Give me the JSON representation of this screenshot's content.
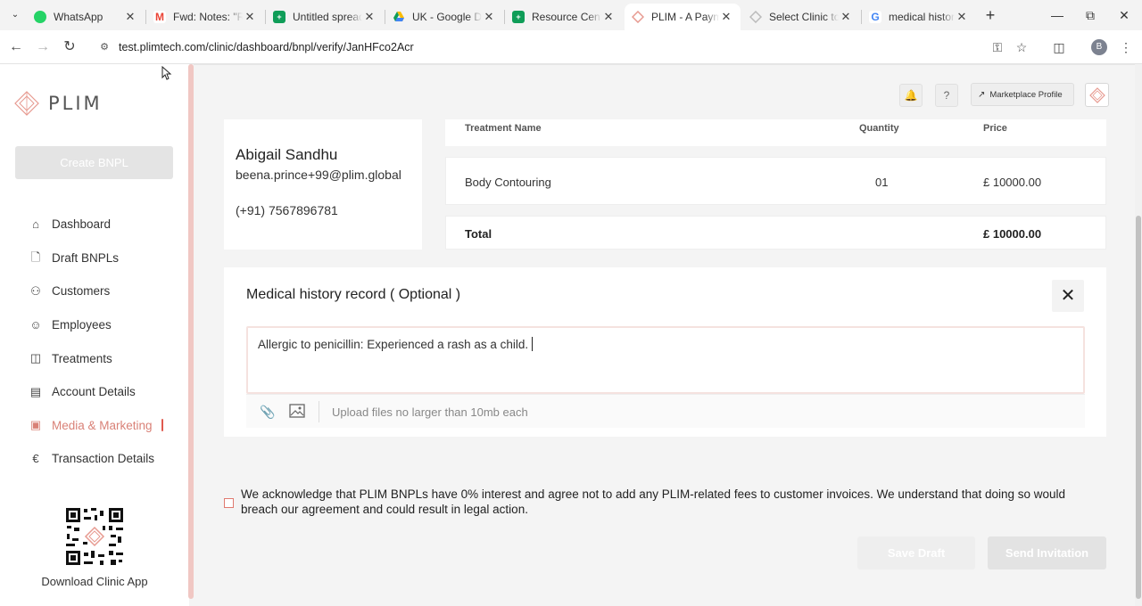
{
  "browser": {
    "tabs": [
      {
        "title": "WhatsApp",
        "favicon": "whatsapp-icon",
        "color": "#25d366"
      },
      {
        "title": "Fwd: Notes: \"Re",
        "favicon": "gmail-icon",
        "color": "#ea4335"
      },
      {
        "title": "Untitled spreads",
        "favicon": "sheets-icon",
        "color": "#0f9d58"
      },
      {
        "title": "UK - Google Driv",
        "favicon": "drive-icon",
        "color": "#4285f4"
      },
      {
        "title": "Resource Centre",
        "favicon": "sheets-icon",
        "color": "#0f9d58"
      },
      {
        "title": "PLIM - A Paymen",
        "favicon": "plim-icon",
        "color": "#e79a90"
      },
      {
        "title": "Select Clinic to c",
        "favicon": "plim-icon",
        "color": "#bbbbbb"
      },
      {
        "title": "medical history c",
        "favicon": "google-icon",
        "color": "#4285f4"
      }
    ],
    "active_tab": 5,
    "url": "test.plimtech.com/clinic/dashboard/bnpl/verify/JanHFco2Acr",
    "profile_initial": "B"
  },
  "sidebar": {
    "brand": "PLIM",
    "create_button": "Create BNPL",
    "items": [
      {
        "label": "Dashboard",
        "icon": "home-icon"
      },
      {
        "label": "Draft BNPLs",
        "icon": "file-icon"
      },
      {
        "label": "Customers",
        "icon": "users-icon"
      },
      {
        "label": "Employees",
        "icon": "user-plus-icon"
      },
      {
        "label": "Treatments",
        "icon": "treatments-icon"
      },
      {
        "label": "Account Details",
        "icon": "id-card-icon"
      },
      {
        "label": "Media & Marketing",
        "icon": "image-icon"
      },
      {
        "label": "Transaction Details",
        "icon": "currency-icon"
      }
    ],
    "active_item": "Media & Marketing",
    "download_label": "Download Clinic App"
  },
  "header": {
    "marketplace_label": "Marketplace Profile"
  },
  "customer": {
    "name": "Abigail Sandhu",
    "email": "beena.prince+99@plim.global",
    "phone": "(+91) 7567896781"
  },
  "treatments": {
    "columns": [
      "Treatment Name",
      "Quantity",
      "Price"
    ],
    "rows": [
      {
        "name": "Body Contouring",
        "quantity": "01",
        "price": "£ 10000.00"
      }
    ],
    "total_label": "Total",
    "total_value": "£ 10000.00"
  },
  "medical": {
    "title": "Medical history record ( Optional )",
    "value": "Allergic to penicillin: Experienced a rash as a child.",
    "upload_hint": "Upload files no larger than 10mb each"
  },
  "acknowledgement": {
    "text": "We acknowledge that PLIM BNPLs have 0% interest and agree not to add any PLIM-related fees to customer invoices. We understand that doing so would breach our agreement and could result in legal action.",
    "checked": false
  },
  "actions": {
    "save_draft": "Save Draft",
    "send_invitation": "Send Invitation"
  },
  "colors": {
    "accent": "#d98177",
    "disabled": "#e4e4e4"
  }
}
